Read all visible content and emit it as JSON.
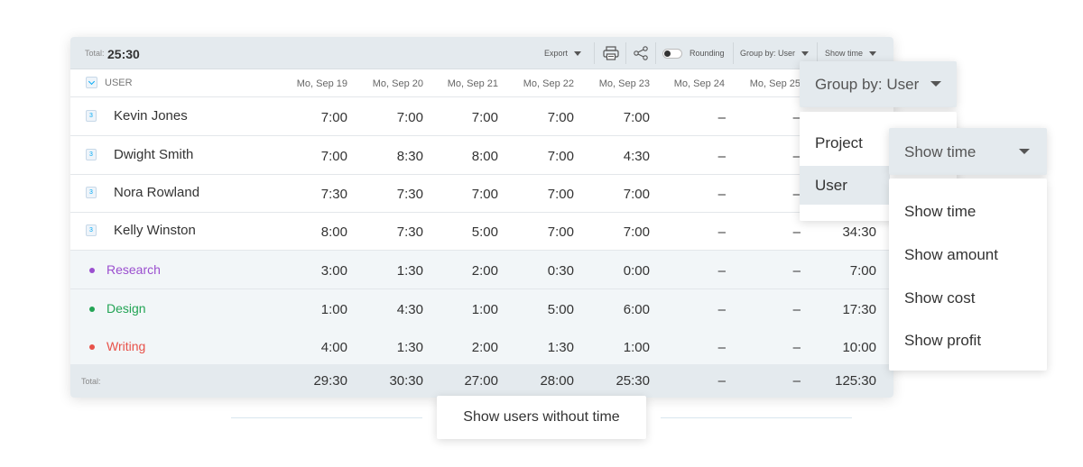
{
  "toolbar": {
    "total_label": "Total:",
    "total_value": "25:30",
    "export_label": "Export",
    "print_icon": "printer-icon",
    "share_icon": "share-icon",
    "rounding_label": "Rounding",
    "group_by_label": "Group by: User",
    "show_time_label": "Show time"
  },
  "table": {
    "user_header": "USER",
    "columns": [
      "Mo, Sep 19",
      "Mo, Sep 20",
      "Mo, Sep 21",
      "Mo, Sep 22",
      "Mo, Sep 23",
      "Mo, Sep 24",
      "Mo, Sep 25"
    ],
    "users": [
      {
        "badge": "3",
        "name": "Kevin Jones",
        "values": [
          "7:00",
          "7:00",
          "7:00",
          "7:00",
          "7:00",
          "–",
          "–"
        ],
        "total": ""
      },
      {
        "badge": "3",
        "name": "Dwight Smith",
        "values": [
          "7:00",
          "8:30",
          "8:00",
          "7:00",
          "4:30",
          "–",
          "–"
        ],
        "total": ""
      },
      {
        "badge": "3",
        "name": "Nora Rowland",
        "values": [
          "7:30",
          "7:30",
          "7:00",
          "7:00",
          "7:00",
          "–",
          "–"
        ],
        "total": ""
      },
      {
        "badge": "3",
        "name": "Kelly Winston",
        "values": [
          "8:00",
          "7:30",
          "5:00",
          "7:00",
          "7:00",
          "–",
          "–"
        ],
        "total": "34:30"
      }
    ],
    "projects": [
      {
        "name": "Research",
        "color": "#9b4fcf",
        "values": [
          "3:00",
          "1:30",
          "2:00",
          "0:30",
          "0:00",
          "–",
          "–"
        ],
        "total": "7:00"
      },
      {
        "name": "Design",
        "color": "#23a455",
        "values": [
          "1:00",
          "4:30",
          "1:00",
          "5:00",
          "6:00",
          "–",
          "–"
        ],
        "total": "17:30"
      },
      {
        "name": "Writing",
        "color": "#e8524a",
        "values": [
          "4:00",
          "1:30",
          "2:00",
          "1:30",
          "1:00",
          "–",
          "–"
        ],
        "total": "10:00"
      }
    ],
    "footer": {
      "label": "Total:",
      "values": [
        "29:30",
        "30:30",
        "27:00",
        "28:00",
        "25:30",
        "–",
        "–"
      ],
      "total": "125:30"
    }
  },
  "group_by_dropdown": {
    "label": "Group by: User",
    "options": [
      "Project",
      "User"
    ],
    "selected": "User"
  },
  "show_time_dropdown": {
    "label": "Show time",
    "options": [
      "Show time",
      "Show amount",
      "Show cost",
      "Show profit"
    ]
  },
  "show_users_button": "Show users without time"
}
